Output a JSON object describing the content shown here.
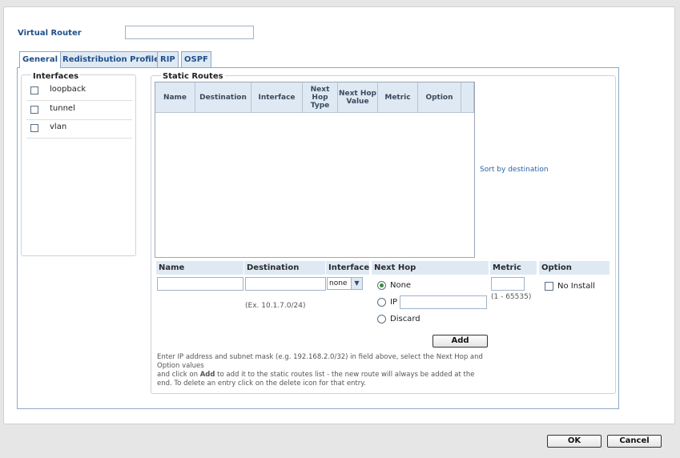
{
  "virtual_router": {
    "label": "Virtual Router",
    "value": ""
  },
  "tabs": [
    {
      "label": "General"
    },
    {
      "label": "Redistribution Profiles"
    },
    {
      "label": "RIP"
    },
    {
      "label": "OSPF"
    }
  ],
  "interfaces": {
    "legend": "Interfaces",
    "items": [
      {
        "label": "loopback",
        "checked": false
      },
      {
        "label": "tunnel",
        "checked": false
      },
      {
        "label": "vlan",
        "checked": false
      }
    ]
  },
  "static_routes": {
    "legend": "Static Routes",
    "columns": [
      "Name",
      "Destination",
      "Interface",
      "Next Hop Type",
      "Next Hop Value",
      "Metric",
      "Option"
    ],
    "rows": [],
    "sort_link": "Sort by destination"
  },
  "form": {
    "headers": {
      "name": "Name",
      "destination": "Destination",
      "interface": "Interface",
      "next_hop": "Next Hop",
      "metric": "Metric",
      "option": "Option"
    },
    "name_value": "",
    "destination_value": "",
    "destination_example": "(Ex. 10.1.7.0/24)",
    "interface_selected": "none",
    "next_hop_options": {
      "none": "None",
      "ip": "IP",
      "discard": "Discard"
    },
    "next_hop_selected": "none",
    "ip_value": "",
    "metric_value": "",
    "metric_range": "(1 - 65535)",
    "no_install_label": "No Install",
    "add_label": "Add",
    "hint_line1": "Enter IP address and subnet mask (e.g. 192.168.2.0/32) in field above, select the Next Hop and Option values",
    "hint_line2_pre": "and click on ",
    "hint_line2_bold": "Add",
    "hint_line2_post": " to add it to the static routes list - the new route will always be added at the end. To delete an entry click on the delete icon for that entry."
  },
  "footer": {
    "ok_label": "OK",
    "cancel_label": "Cancel"
  },
  "colors": {
    "accent": "#1f4f8a",
    "header_bg": "#dfe9f4",
    "link": "#2a63a8"
  }
}
